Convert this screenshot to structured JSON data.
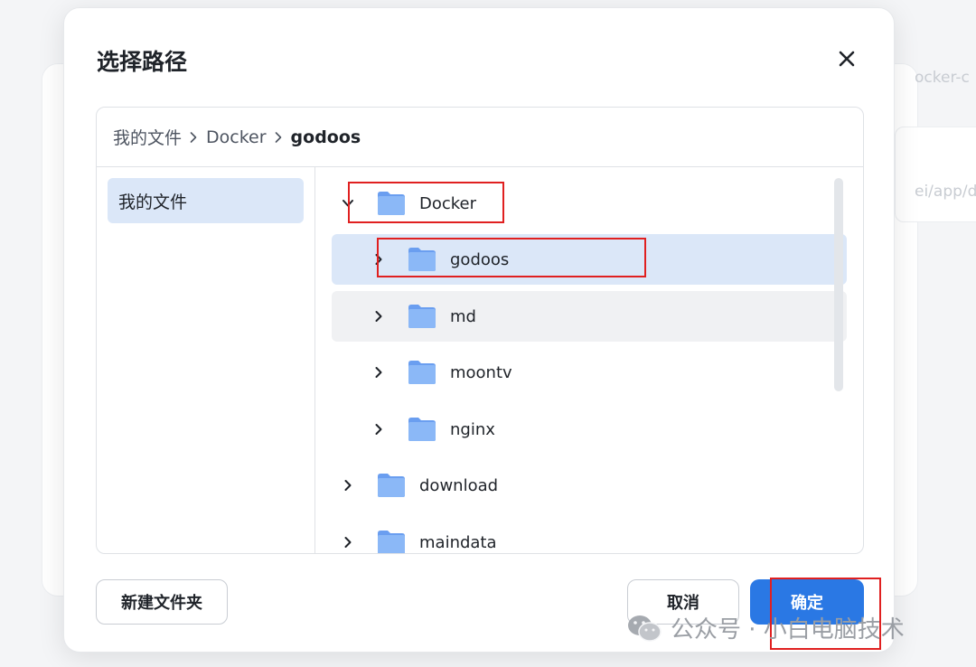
{
  "background": {
    "text_top": "ocker-c",
    "text_mid": "ei/app/d"
  },
  "dialog": {
    "title": "选择路径",
    "close_icon": "close-icon"
  },
  "breadcrumb": {
    "items": [
      "我的文件",
      "Docker",
      "godoos"
    ],
    "separator_icon": "chevron-right-icon"
  },
  "sidebar": {
    "items": [
      {
        "label": "我的文件",
        "selected": true
      }
    ]
  },
  "tree": {
    "items": [
      {
        "label": "Docker",
        "depth": 0,
        "expanded": true,
        "state": "normal"
      },
      {
        "label": "godoos",
        "depth": 1,
        "expanded": false,
        "state": "selected"
      },
      {
        "label": "md",
        "depth": 1,
        "expanded": false,
        "state": "hover"
      },
      {
        "label": "moontv",
        "depth": 1,
        "expanded": false,
        "state": "normal"
      },
      {
        "label": "nginx",
        "depth": 1,
        "expanded": false,
        "state": "normal"
      },
      {
        "label": "download",
        "depth": 0,
        "expanded": false,
        "state": "normal"
      },
      {
        "label": "maindata",
        "depth": 0,
        "expanded": false,
        "state": "normal"
      }
    ],
    "folder_icon": "folder-icon"
  },
  "footer": {
    "new_folder_label": "新建文件夹",
    "cancel_label": "取消",
    "confirm_label": "确定"
  },
  "watermark": {
    "text": "公众号 · 小白电脑技术",
    "icon": "wechat-icon"
  },
  "colors": {
    "primary": "#2a78e4",
    "selected_bg": "#dbe7f8",
    "annotation": "#e02020",
    "folder": "#7fb0f5"
  }
}
